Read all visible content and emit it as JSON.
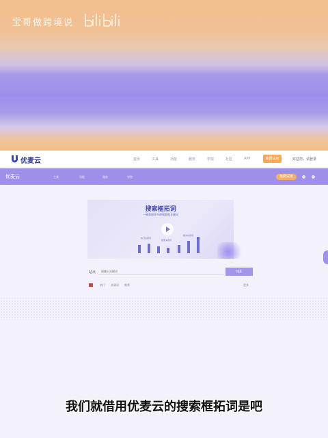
{
  "banner": {
    "watermark": "宝哥做跨境说",
    "logo_icon": "bilibili-logo"
  },
  "site_nav": {
    "logo_text": "优麦云",
    "links": [
      "首页",
      "工具",
      "功能",
      "服务",
      "学院",
      "社区",
      "APP"
    ],
    "cta": "免费试用",
    "user": "欢迎您，请登录"
  },
  "purple_bar": {
    "logo_text": "优麦云",
    "links": [
      "工具",
      "功能",
      "服务",
      "学院"
    ],
    "cta": "免费试用"
  },
  "hero": {
    "title": "搜索框拓词",
    "subtitle": "一键获取亚马逊搜索框关键词",
    "labels": [
      "热门关键词",
      "搜索关键词",
      "相关关键词"
    ]
  },
  "search": {
    "label": "站点",
    "placeholder": "请输入关键词",
    "button": "搜索",
    "hints": [
      "热门",
      "关键词",
      "推荐"
    ],
    "right_hint": "更多"
  },
  "subtitle": "我们就借用优麦云的搜索框拓词是吧",
  "colors": {
    "accent_purple": "#9f8fe9",
    "orange": "#f2be8c",
    "cta_orange": "#f6a95a"
  }
}
